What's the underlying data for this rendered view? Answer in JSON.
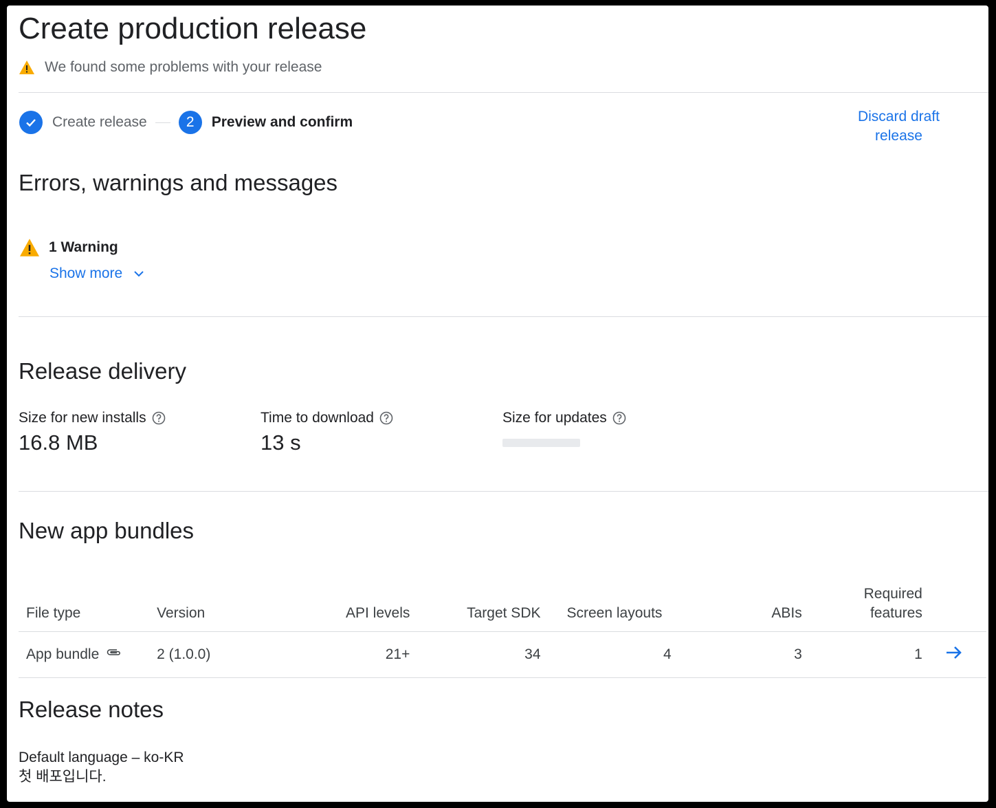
{
  "header": {
    "title": "Create production release",
    "warning_text": "We found some problems with your release"
  },
  "stepper": {
    "step1_label": "Create release",
    "step2_number": "2",
    "step2_label": "Preview and confirm",
    "discard_line1": "Discard draft",
    "discard_line2": "release"
  },
  "errors": {
    "heading": "Errors, warnings and messages",
    "warning_count_label": "1 Warning",
    "show_more": "Show more"
  },
  "delivery": {
    "heading": "Release delivery",
    "metrics": [
      {
        "label": "Size for new installs",
        "value": "16.8 MB"
      },
      {
        "label": "Time to download",
        "value": "13 s"
      },
      {
        "label": "Size for updates",
        "value": ""
      }
    ]
  },
  "bundles": {
    "heading": "New app bundles",
    "columns": [
      "File type",
      "Version",
      "API levels",
      "Target SDK",
      "Screen layouts",
      "ABIs",
      "Required features"
    ],
    "rows": [
      {
        "file_type": "App bundle",
        "version": "2 (1.0.0)",
        "api_levels": "21+",
        "target_sdk": "34",
        "screen_layouts": "4",
        "abis": "3",
        "required_features": "1"
      }
    ]
  },
  "notes": {
    "heading": "Release notes",
    "language_line": "Default language – ko-KR",
    "text": "첫 배포입니다."
  },
  "colors": {
    "accent": "#1a73e8",
    "warning": "#f9ab00",
    "divider": "#dadce0"
  },
  "icons": [
    "warning-icon",
    "check-icon",
    "chevron-down-icon",
    "help-icon",
    "paperclip-icon",
    "arrow-right-icon"
  ]
}
